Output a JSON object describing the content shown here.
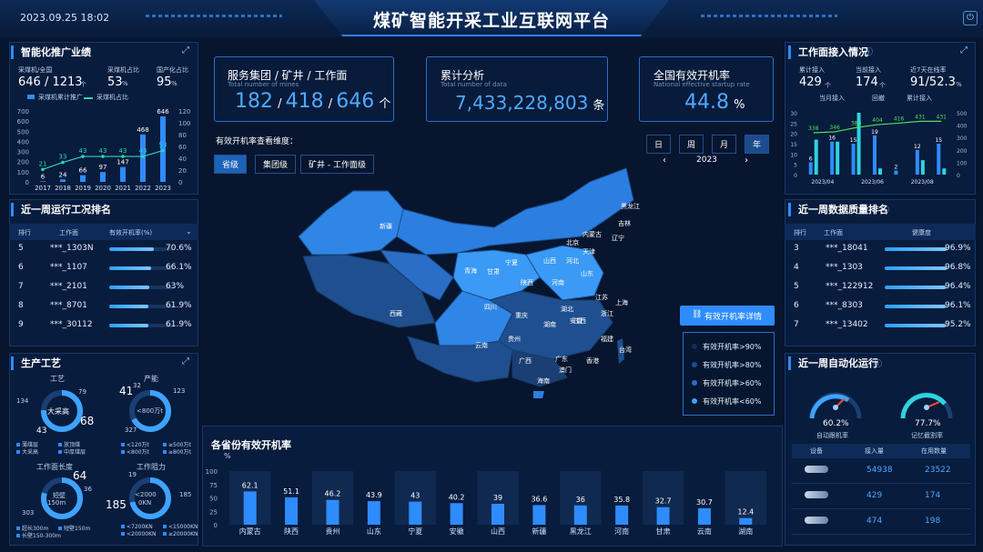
{
  "header": {
    "title": "煤矿智能开采工业互联网平台",
    "datetime": "2023.09.25 18:02"
  },
  "left_top": {
    "title": "智能化推广业绩",
    "metric1_label": "采煤机/全国",
    "metric1_value": "646 / 1213",
    "metric1_unit": "个",
    "metric2_label": "采煤机占比",
    "metric2_value": "53",
    "metric2_unit": "%",
    "metric3_label": "国产化占比",
    "metric3_value": "95",
    "metric3_unit": "%",
    "legend1": "采煤机累计推广",
    "legend2": "采煤机占比"
  },
  "left_chart": {
    "type": "bar",
    "categories": [
      "2017",
      "2018",
      "2019",
      "2020",
      "2021",
      "2022",
      "2023"
    ],
    "series": [
      {
        "name": "采煤机累计推广",
        "values": [
          6,
          24,
          66,
          97,
          147,
          468,
          646
        ]
      },
      {
        "name": "采煤机占比",
        "values": [
          21,
          33,
          43,
          43,
          43,
          43,
          53
        ]
      }
    ],
    "left_axis": [
      "700",
      "600",
      "500",
      "400",
      "300",
      "200",
      "100",
      "0"
    ],
    "right_axis": [
      "120",
      "100",
      "80",
      "60",
      "40",
      "20",
      "0"
    ]
  },
  "ranking_left": {
    "title": "近一周运行工况排名",
    "headers": [
      "排行",
      "工作面",
      "有效开机率(%)"
    ],
    "rows": [
      {
        "rank": "5",
        "name": "***_1303N",
        "value": "70.6%",
        "v": 70.6
      },
      {
        "rank": "6",
        "name": "***_1107",
        "value": "66.1%",
        "v": 66.1
      },
      {
        "rank": "7",
        "name": "***_2101",
        "value": "63%",
        "v": 63
      },
      {
        "rank": "8",
        "name": "***_8701",
        "value": "61.9%",
        "v": 61.9
      },
      {
        "rank": "9",
        "name": "***_30112",
        "value": "61.9%",
        "v": 61.9
      }
    ]
  },
  "process": {
    "title": "生产工艺",
    "c1_title": "工艺",
    "c1_center": "大采高",
    "c1_a": "134",
    "c1_b": "79",
    "c1_c": "43",
    "c1_d": "68",
    "c1_legend": [
      "薄煤层",
      "放顶煤",
      "大采高",
      "中厚煤层"
    ],
    "c2_title": "产能",
    "c2_center": "<800万t",
    "c2_a": "41",
    "c2_b": "32",
    "c2_c": "123",
    "c2_d": "327",
    "c2_legend": [
      "<120万t",
      "≥500万t",
      "<800万t",
      "≥800万t"
    ],
    "c3_title": "工作面长度",
    "c3_center1": "短壁",
    "c3_center2": "150m",
    "c3_a": "64",
    "c3_b": "36",
    "c3_c": "303",
    "c3_legend": [
      "超长300m",
      "短壁150m",
      "长壁150-300m"
    ],
    "c4_title": "工作阻力",
    "c4_center1": "<2000",
    "c4_center2": "0KN",
    "c4_a": "19",
    "c4_b": "185",
    "c4_c": "185",
    "c4_legend": [
      "<7200KN",
      "<15000KN",
      "<20000KN",
      "≥20000KN"
    ]
  },
  "kpi": [
    {
      "title": "服务集团 / 矿井 / 工作面",
      "sub": "Total number of mines",
      "v1": "182",
      "v2": "418",
      "v3": "646",
      "unit": "个"
    },
    {
      "title": "累计分析",
      "sub": "Total number of data",
      "value": "7,433,228,803",
      "unit": "条"
    },
    {
      "title": "全国有效开机率",
      "sub": "National effective startup rate",
      "value": "44.8",
      "unit": "%"
    }
  ],
  "map": {
    "dimension_label": "有效开机率查看维度：",
    "tabs": [
      "省级",
      "集团级",
      "矿井 - 工作面级"
    ],
    "time_tabs": [
      "日",
      "周",
      "月",
      "年"
    ],
    "year": "2023",
    "prev": "‹",
    "next": "›",
    "detail_button": "有效开机率详情",
    "legend": [
      "有效开机率>90%",
      "有效开机率>80%",
      "有效开机率>60%",
      "有效开机率<60%"
    ],
    "provinces": [
      "黑龙江",
      "吉林",
      "辽宁",
      "北京",
      "天津",
      "河北",
      "山西",
      "山东",
      "河南",
      "江苏",
      "上海",
      "浙江",
      "安徽",
      "湖北",
      "湖南",
      "江西",
      "福建",
      "台湾",
      "广东",
      "广西",
      "海南",
      "澳门",
      "香港",
      "贵州",
      "云南",
      "四川",
      "重庆",
      "陕西",
      "宁夏",
      "甘肃",
      "青海",
      "西藏",
      "新疆",
      "内蒙古"
    ]
  },
  "province_chart": {
    "title": "各省份有效开机率",
    "unit": "%",
    "type": "bar",
    "categories": [
      "内蒙古",
      "陕西",
      "贵州",
      "山东",
      "宁夏",
      "安徽",
      "山西",
      "新疆",
      "黑龙江",
      "河南",
      "甘肃",
      "云南",
      "湖南"
    ],
    "values": [
      62.1,
      51.1,
      46.2,
      43.9,
      43,
      40.2,
      39,
      36.6,
      36,
      35.8,
      32.7,
      30.7,
      12.4
    ],
    "yaxis": [
      "100",
      "75",
      "50",
      "25",
      "0"
    ]
  },
  "access": {
    "title": "工作面接入情况",
    "m1_label": "累计接入",
    "m1_value": "429",
    "m1_unit": "个",
    "m2_label": "当前接入",
    "m2_value": "174",
    "m2_unit": "个",
    "m3_label": "近7天在线率",
    "m3_value": "91/52.3",
    "m3_unit": "%",
    "legend": [
      "当月接入",
      "回撤",
      "累计接入"
    ]
  },
  "access_chart": {
    "categories": [
      "2023/04",
      "2023/06",
      "2023/08"
    ],
    "bars_a": [
      6,
      16,
      15,
      19,
      2,
      12,
      15
    ],
    "bars_b": [
      17,
      16,
      38,
      3,
      0,
      7,
      3
    ],
    "line": [
      338,
      346,
      380,
      404,
      416,
      431,
      431
    ],
    "left_axis": [
      "30",
      "25",
      "20",
      "15",
      "10",
      "5",
      "0"
    ],
    "right_axis": [
      "500",
      "400",
      "300",
      "200",
      "100",
      "0"
    ]
  },
  "ranking_right": {
    "title": "近一周数据质量排名",
    "headers": [
      "排行",
      "工作面",
      "健康度"
    ],
    "rows": [
      {
        "rank": "3",
        "name": "***_18041",
        "value": "96.9%",
        "v": 96.9
      },
      {
        "rank": "4",
        "name": "***_1303",
        "value": "96.8%",
        "v": 96.8
      },
      {
        "rank": "5",
        "name": "***_122912",
        "value": "96.4%",
        "v": 96.4
      },
      {
        "rank": "6",
        "name": "***_8303",
        "value": "96.1%",
        "v": 96.1
      },
      {
        "rank": "7",
        "name": "***_13402",
        "value": "95.2%",
        "v": 95.2
      }
    ]
  },
  "auto": {
    "title": "近一周自动化运行",
    "g1_value": "60.2%",
    "g1_label": "自动跟机率",
    "g2_value": "77.7%",
    "g2_label": "记忆截割率",
    "headers": [
      "设备",
      "接入量",
      "在用数量"
    ],
    "rows": [
      {
        "icon": "shearer-icon",
        "a": "54938",
        "b": "23522"
      },
      {
        "icon": "support-icon",
        "a": "429",
        "b": "174"
      },
      {
        "icon": "conveyor-icon",
        "a": "474",
        "b": "198"
      }
    ]
  }
}
